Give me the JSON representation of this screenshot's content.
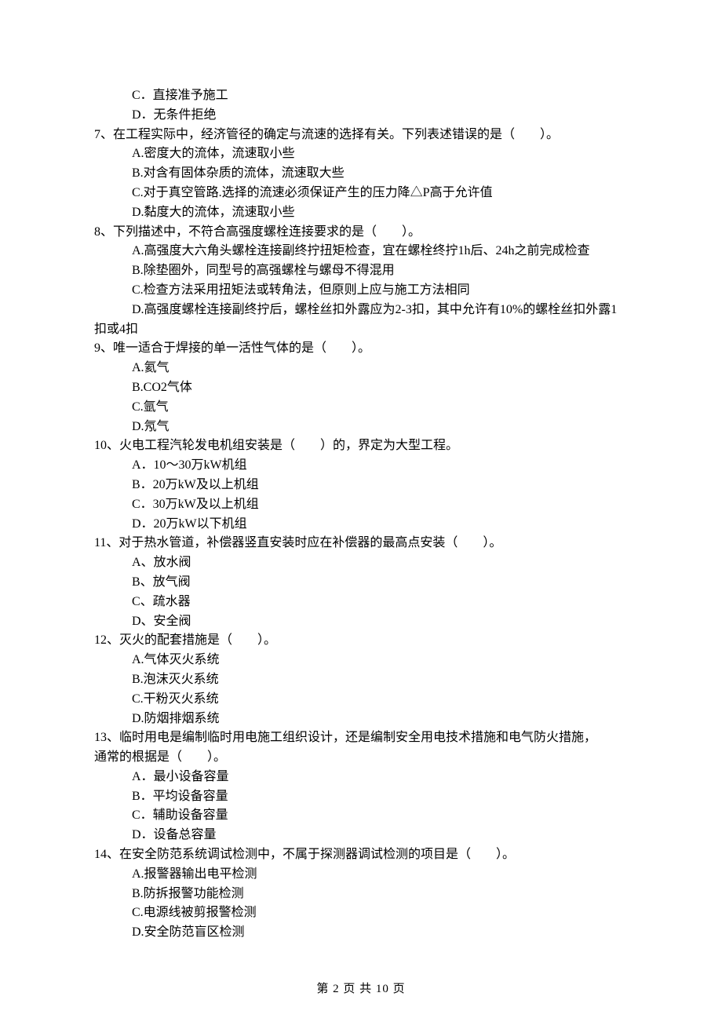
{
  "items": [
    {
      "cls": "option-line",
      "path": "t.q6.optC"
    },
    {
      "cls": "option-line",
      "path": "t.q6.optD"
    },
    {
      "cls": "question-line",
      "path": "t.q7.stem"
    },
    {
      "cls": "option-line",
      "path": "t.q7.optA"
    },
    {
      "cls": "option-line",
      "path": "t.q7.optB"
    },
    {
      "cls": "option-line",
      "path": "t.q7.optC"
    },
    {
      "cls": "option-line",
      "path": "t.q7.optD"
    },
    {
      "cls": "question-line",
      "path": "t.q8.stem"
    },
    {
      "cls": "option-line",
      "path": "t.q8.optA"
    },
    {
      "cls": "option-line",
      "path": "t.q8.optB"
    },
    {
      "cls": "option-line",
      "path": "t.q8.optC"
    },
    {
      "cls": "option-line",
      "path": "t.q8.optD1"
    },
    {
      "cls": "cont-line",
      "path": "t.q8.optD2"
    },
    {
      "cls": "question-line",
      "path": "t.q9.stem"
    },
    {
      "cls": "option-line",
      "path": "t.q9.optA"
    },
    {
      "cls": "option-line",
      "path": "t.q9.optB"
    },
    {
      "cls": "option-line",
      "path": "t.q9.optC"
    },
    {
      "cls": "option-line",
      "path": "t.q9.optD"
    },
    {
      "cls": "question-line",
      "path": "t.q10.stem"
    },
    {
      "cls": "option-line",
      "path": "t.q10.optA"
    },
    {
      "cls": "option-line",
      "path": "t.q10.optB"
    },
    {
      "cls": "option-line",
      "path": "t.q10.optC"
    },
    {
      "cls": "option-line",
      "path": "t.q10.optD"
    },
    {
      "cls": "question-line",
      "path": "t.q11.stem"
    },
    {
      "cls": "option-line",
      "path": "t.q11.optA"
    },
    {
      "cls": "option-line",
      "path": "t.q11.optB"
    },
    {
      "cls": "option-line",
      "path": "t.q11.optC"
    },
    {
      "cls": "option-line",
      "path": "t.q11.optD"
    },
    {
      "cls": "question-line",
      "path": "t.q12.stem"
    },
    {
      "cls": "option-line",
      "path": "t.q12.optA"
    },
    {
      "cls": "option-line",
      "path": "t.q12.optB"
    },
    {
      "cls": "option-line",
      "path": "t.q12.optC"
    },
    {
      "cls": "option-line",
      "path": "t.q12.optD"
    },
    {
      "cls": "question-line",
      "path": "t.q13.stem1"
    },
    {
      "cls": "cont-line",
      "path": "t.q13.stem2"
    },
    {
      "cls": "option-line",
      "path": "t.q13.optA"
    },
    {
      "cls": "option-line",
      "path": "t.q13.optB"
    },
    {
      "cls": "option-line",
      "path": "t.q13.optC"
    },
    {
      "cls": "option-line",
      "path": "t.q13.optD"
    },
    {
      "cls": "question-line",
      "path": "t.q14.stem"
    },
    {
      "cls": "option-line",
      "path": "t.q14.optA"
    },
    {
      "cls": "option-line",
      "path": "t.q14.optB"
    },
    {
      "cls": "option-line",
      "path": "t.q14.optC"
    },
    {
      "cls": "option-line",
      "path": "t.q14.optD"
    }
  ],
  "t": {
    "q6": {
      "optC": "C．直接准予施工",
      "optD": "D．无条件拒绝"
    },
    "q7": {
      "stem": "7、在工程实际中，经济管径的确定与流速的选择有关。下列表述错误的是（　　）。",
      "optA": "A.密度大的流体，流速取小些",
      "optB": "B.对含有固体杂质的流体，流速取大些",
      "optC": "C.对于真空管路.选择的流速必须保证产生的压力降△P高于允许值",
      "optD": "D.黏度大的流体，流速取小些"
    },
    "q8": {
      "stem": "8、下列描述中，不符合高强度螺栓连接要求的是（　　）。",
      "optA": "A.高强度大六角头螺栓连接副终拧扭矩检查，宜在螺栓终拧1h后、24h之前完成检查",
      "optB": "B.除垫圈外，同型号的高强螺栓与螺母不得混用",
      "optC": "C.检查方法采用扭矩法或转角法，但原则上应与施工方法相同",
      "optD1": "D.高强度螺栓连接副终拧后，螺栓丝扣外露应为2-3扣，其中允许有10%的螺栓丝扣外露1",
      "optD2": "扣或4扣"
    },
    "q9": {
      "stem": "9、唯一适合于焊接的单一活性气体的是（　　）。",
      "optA": "A.氦气",
      "optB": "B.CO2气体",
      "optC": "C.氩气",
      "optD": "D.氖气"
    },
    "q10": {
      "stem": "10、火电工程汽轮发电机组安装是（　　）的，界定为大型工程。",
      "optA": "A．10～30万kW机组",
      "optB": "B．20万kW及以上机组",
      "optC": "C．30万kW及以上机组",
      "optD": "D．20万kW以下机组"
    },
    "q11": {
      "stem": "11、对于热水管道，补偿器竖直安装时应在补偿器的最高点安装（　　）。",
      "optA": "A、放水阀",
      "optB": "B、放气阀",
      "optC": "C、疏水器",
      "optD": "D、安全阀"
    },
    "q12": {
      "stem": "12、灭火的配套措施是（　　）。",
      "optA": "A.气体灭火系统",
      "optB": "B.泡沫灭火系统",
      "optC": "C.干粉灭火系统",
      "optD": "D.防烟排烟系统"
    },
    "q13": {
      "stem1": "13、临时用电是编制临时用电施工组织设计，还是编制安全用电技术措施和电气防火措施，",
      "stem2": "通常的根据是（　　）。",
      "optA": "A．最小设备容量",
      "optB": "B．平均设备容量",
      "optC": "C．辅助设备容量",
      "optD": "D．设备总容量"
    },
    "q14": {
      "stem": "14、在安全防范系统调试检测中，不属于探测器调试检测的项目是（　　）。",
      "optA": "A.报警器输出电平检测",
      "optB": "B.防拆报警功能检测",
      "optC": "C.电源线被剪报警检测",
      "optD": "D.安全防范盲区检测"
    }
  },
  "footer": "第 2 页 共 10 页"
}
